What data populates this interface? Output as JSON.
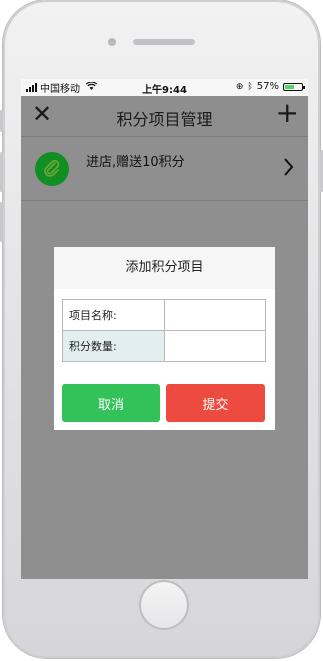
{
  "status_bar": {
    "carrier": "中国移动",
    "time": "上午9:44",
    "battery_percent": "57%",
    "battery_level": 0.57
  },
  "nav": {
    "title": "积分项目管理",
    "close_icon": "✕",
    "add_icon": "+"
  },
  "list": {
    "items": [
      {
        "label": "进店,赠送10积分",
        "icon": "paperclip-icon"
      }
    ]
  },
  "modal": {
    "title": "添加积分项目",
    "fields": [
      {
        "label": "项目名称:",
        "value": ""
      },
      {
        "label": "积分数量:",
        "value": ""
      }
    ],
    "cancel_label": "取消",
    "submit_label": "提交"
  },
  "colors": {
    "cancel": "#33c25a",
    "submit": "#ee4b40",
    "icon_bg": "#118f22",
    "overlay": "#8f8f8f"
  }
}
